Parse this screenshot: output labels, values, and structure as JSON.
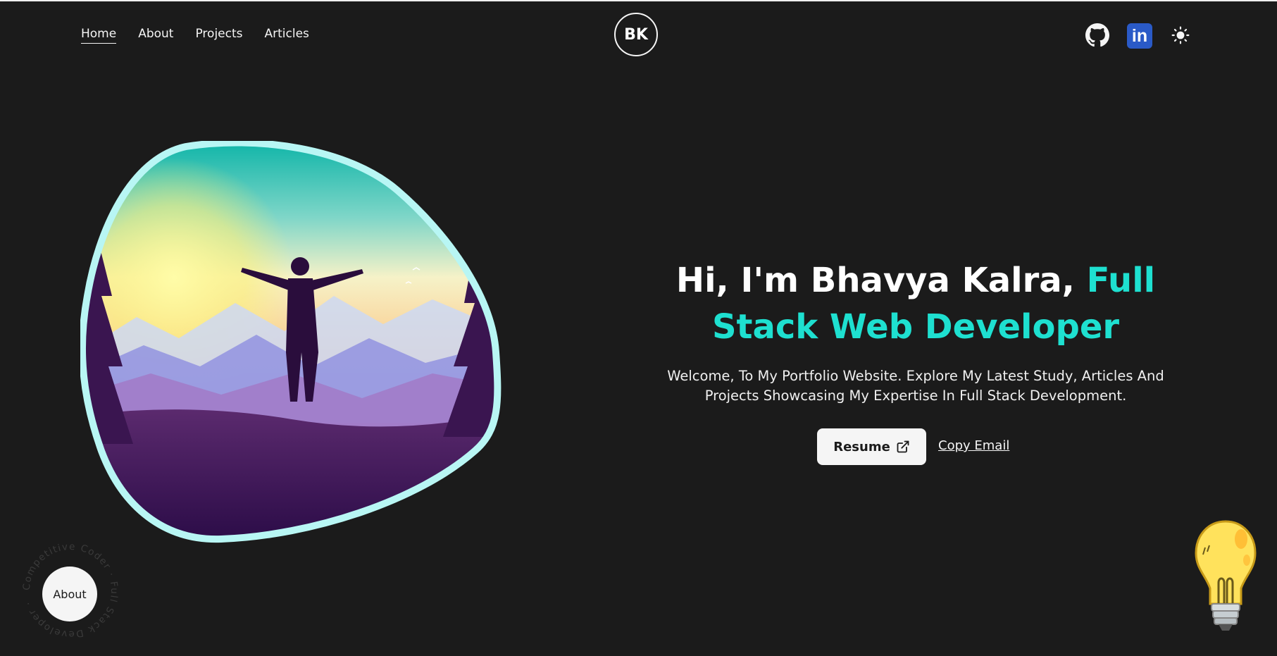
{
  "nav": {
    "items": [
      {
        "label": "Home",
        "active": true
      },
      {
        "label": "About",
        "active": false
      },
      {
        "label": "Projects",
        "active": false
      },
      {
        "label": "Articles",
        "active": false
      }
    ]
  },
  "logo": {
    "initials": "BK"
  },
  "social": {
    "github_icon": "github-icon",
    "linkedin_icon": "linkedin-icon",
    "linkedin_text": "in",
    "theme_icon": "sun-icon"
  },
  "hero": {
    "headline_part1": "Hi, I'm Bhavya Kalra, ",
    "headline_part2": "Full Stack Web Developer",
    "subtitle": "Welcome, To My Portfolio Website. Explore My Latest Study, Articles And Projects Showcasing My Expertise In Full Stack Development.",
    "resume_label": "Resume",
    "copy_email_label": "Copy Email"
  },
  "about_badge": {
    "label": "About",
    "ring_text": "Competitive Coder · Full Stack Developer ·"
  },
  "colors": {
    "background": "#1b1b1b",
    "accent": "#1ee0d0",
    "frame": "#b8f6f4",
    "linkedin": "#2a5ac7"
  }
}
